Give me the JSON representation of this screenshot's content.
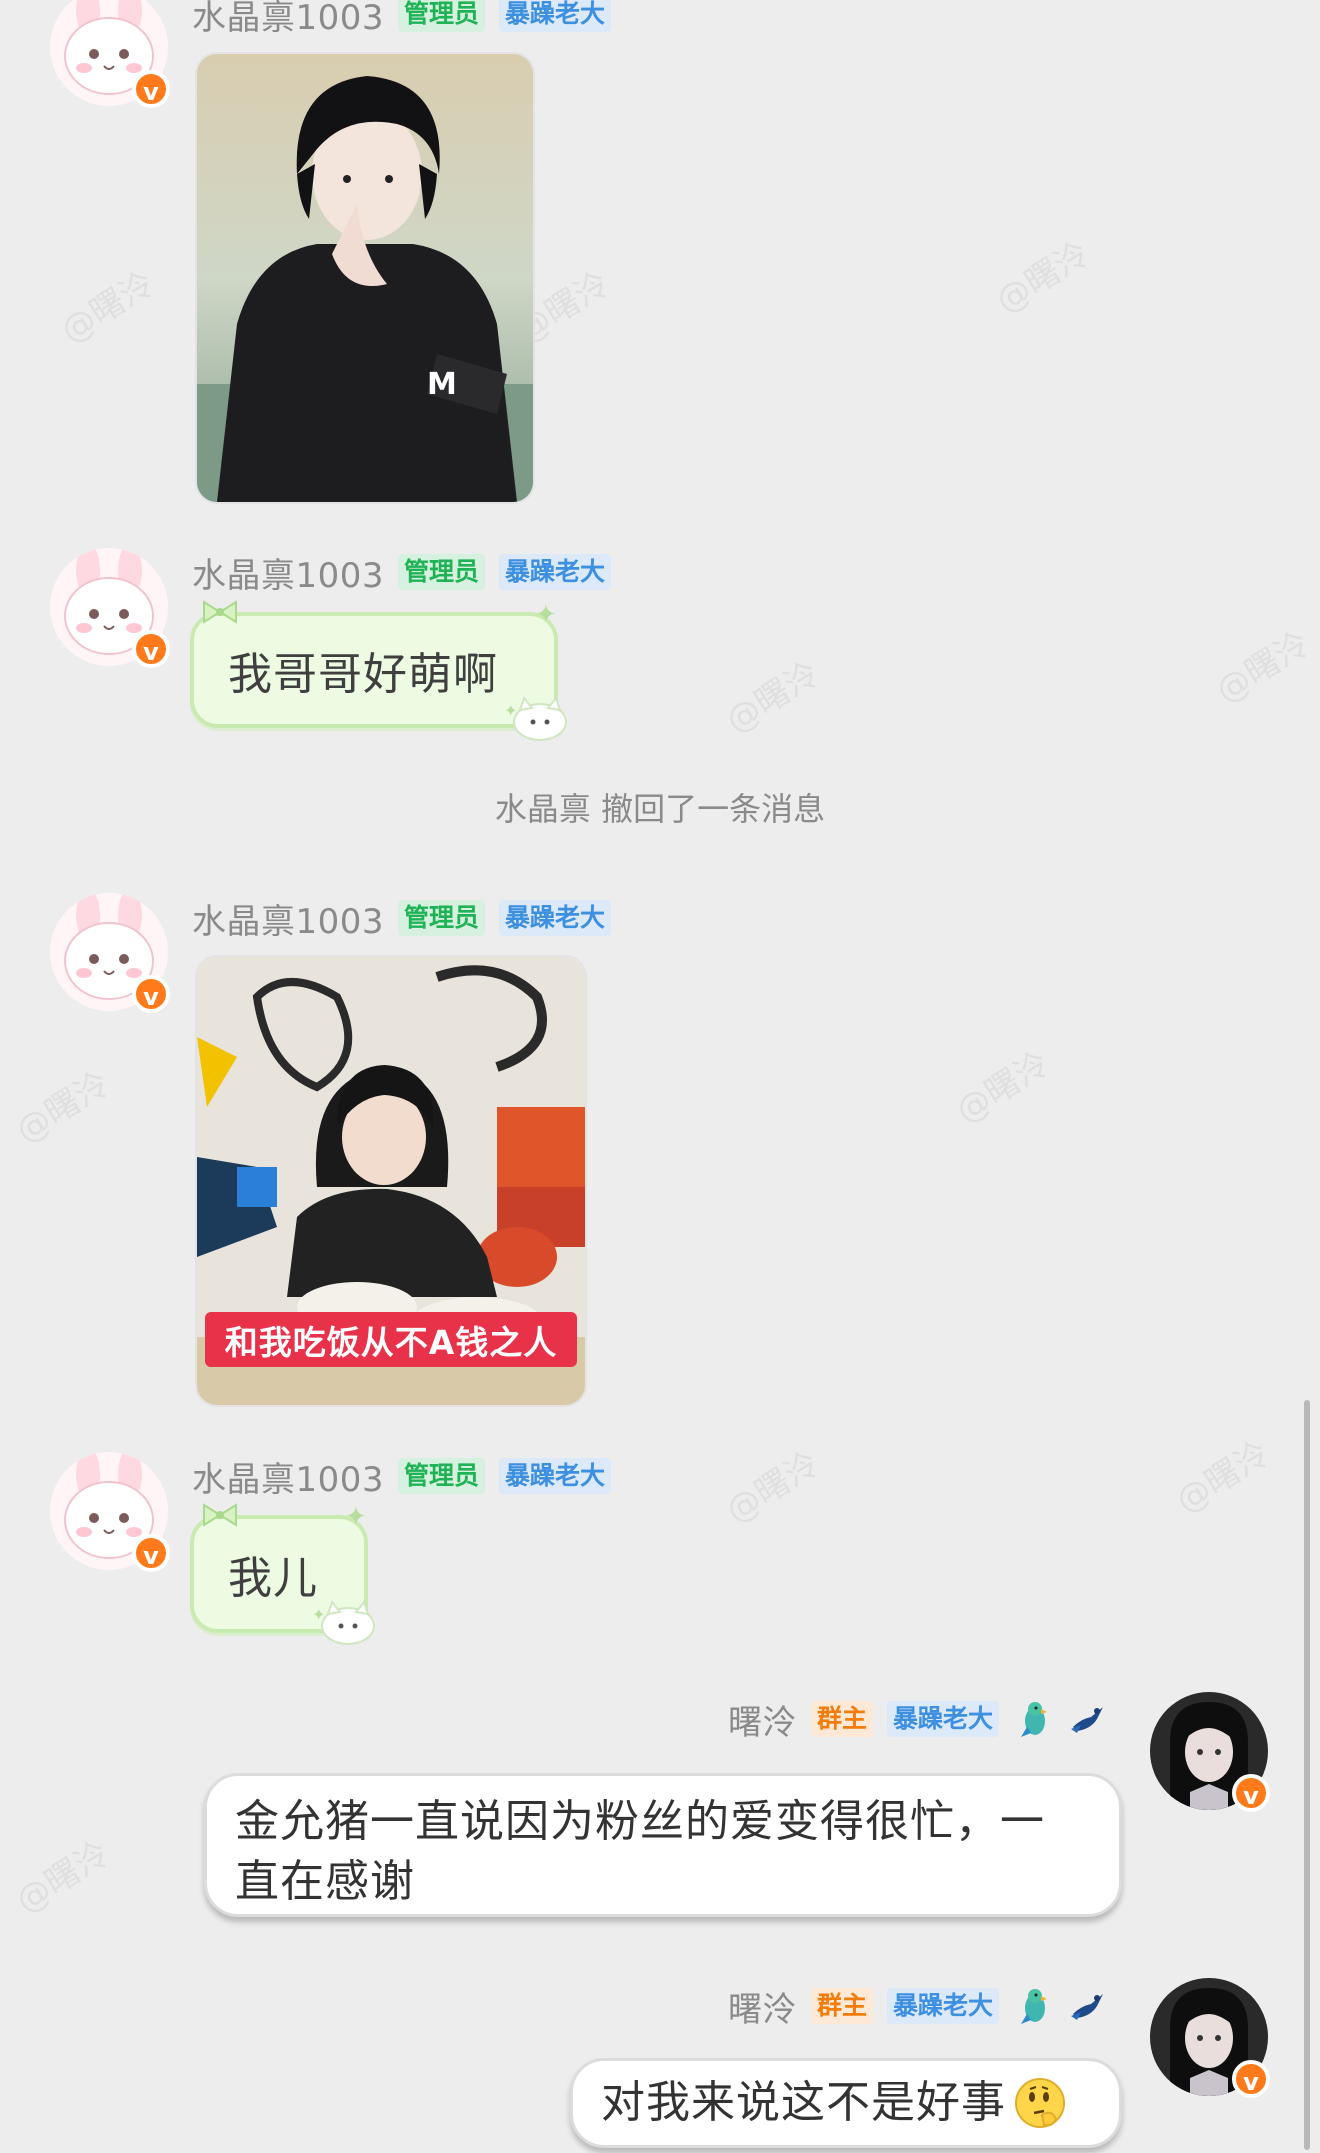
{
  "watermark": "@曙泠",
  "messages": [
    {
      "user": "水晶禀1003",
      "tags": [
        "管理员",
        "暴躁老大"
      ],
      "type": "image",
      "image_desc": "photo-young-man"
    },
    {
      "user": "水晶禀1003",
      "tags": [
        "管理员",
        "暴躁老大"
      ],
      "type": "text",
      "text": "我哥哥好萌啊"
    },
    {
      "type": "system",
      "text": "水晶禀 撤回了一条消息"
    },
    {
      "user": "水晶禀1003",
      "tags": [
        "管理员",
        "暴躁老大"
      ],
      "type": "image",
      "caption": "和我吃饭从不A钱之人"
    },
    {
      "user": "水晶禀1003",
      "tags": [
        "管理员",
        "暴躁老大"
      ],
      "type": "text",
      "text": "我儿"
    },
    {
      "user": "曙泠",
      "tags": [
        "群主",
        "暴躁老大"
      ],
      "type": "text",
      "text_line1": "金允猪一直说因为粉丝的爱变得很忙，一",
      "text_line2": "直在感谢"
    },
    {
      "user": "曙泠",
      "tags": [
        "群主",
        "暴躁老大"
      ],
      "type": "text",
      "text": "对我来说这不是好事",
      "emoji": "thinking-emoji"
    }
  ],
  "colors": {
    "admin_tag": "#1fb356",
    "boss_tag": "#3d8fe0",
    "owner_tag": "#f27d0c",
    "verified_badge": "#ff7a1a"
  }
}
